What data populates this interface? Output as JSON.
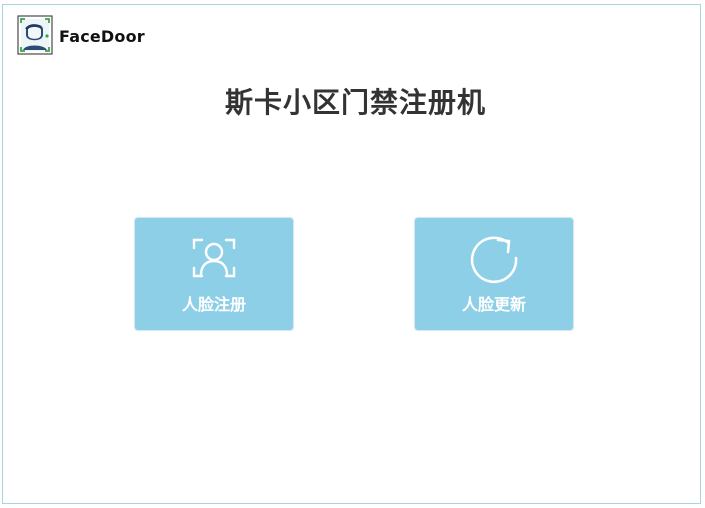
{
  "app": {
    "brand_name": "FaceDoor",
    "logo_icon": "face-scan-logo"
  },
  "page": {
    "title": "斯卡小区门禁注册机"
  },
  "actions": [
    {
      "label": "人脸注册",
      "icon": "face-scan-user-icon"
    },
    {
      "label": "人脸更新",
      "icon": "refresh-icon"
    }
  ],
  "colors": {
    "tile_background": "#8ecfe8",
    "title_text": "#333333",
    "frame_border": "#a9d3e3"
  }
}
